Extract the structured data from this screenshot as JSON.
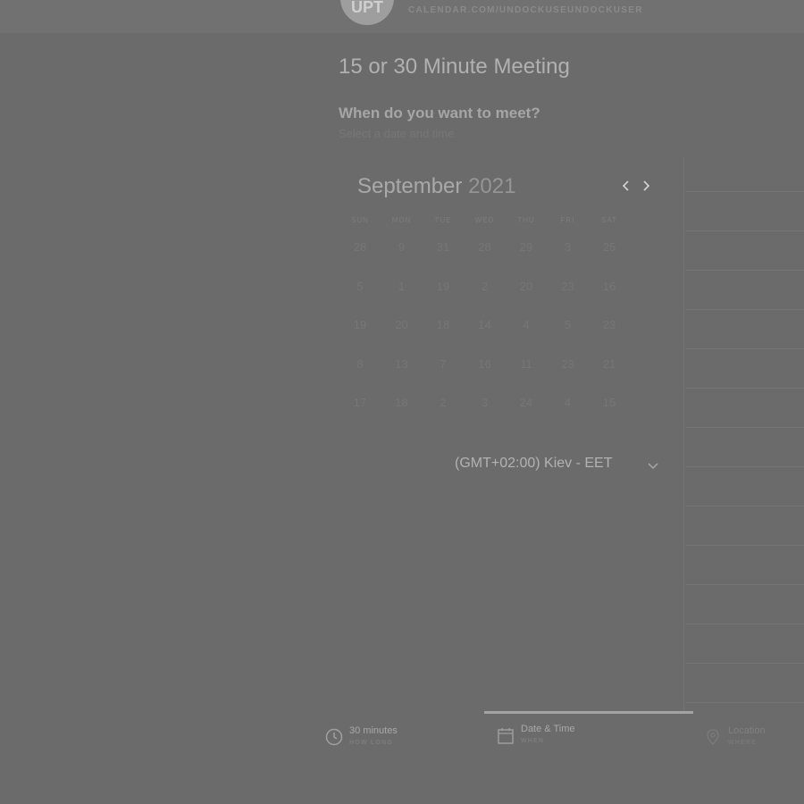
{
  "header": {
    "avatar_initials": "UPT",
    "calendar_url": "CALENDAR.COM/UNDOCKUSEUNDOCKUSER"
  },
  "meeting": {
    "title": "15 or 30 Minute Meeting",
    "question": "When do you want to meet?",
    "subtitle": "Select a date and time"
  },
  "calendar": {
    "month": "September",
    "year": "2021",
    "weekdays": [
      "SUN",
      "MON",
      "TUE",
      "WED",
      "THU",
      "FRI",
      "SAT"
    ],
    "weeks": [
      [
        "28",
        "9",
        "31",
        "28",
        "29",
        "3",
        "25"
      ],
      [
        "5",
        "1",
        "19",
        "2",
        "20",
        "23",
        "16"
      ],
      [
        "19",
        "20",
        "18",
        "14",
        "4",
        "5",
        "23"
      ],
      [
        "8",
        "13",
        "7",
        "16",
        "11",
        "23",
        "21"
      ],
      [
        "17",
        "18",
        "2",
        "3",
        "24",
        "4",
        "15"
      ]
    ]
  },
  "timezone": {
    "selected": "(GMT+02:00) Kiev - EET"
  },
  "steps": [
    {
      "title": "30 minutes",
      "subtitle": "HOW LONG",
      "icon": "clock-icon"
    },
    {
      "title": "Date & Time",
      "subtitle": "WHEN",
      "icon": "calendar-icon"
    },
    {
      "title": "Location",
      "subtitle": "WHERE",
      "icon": "location-pin-icon"
    }
  ],
  "colors": {
    "overlay": "#6b6b6b",
    "active_step": "#a3a3a3"
  }
}
